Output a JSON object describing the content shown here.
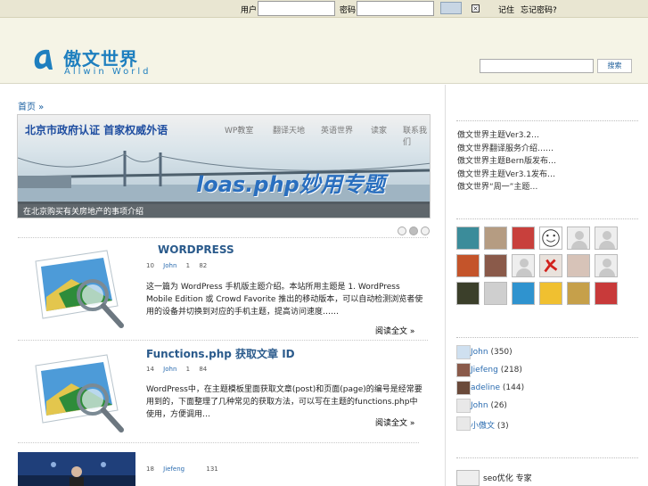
{
  "topbar": {
    "username_label": "用户",
    "password_label": "密码",
    "username_value": "",
    "password_value": "",
    "remember_label": "记住",
    "forgot_label": "忘记密码?"
  },
  "header": {
    "logo_cn": "傲文世界",
    "logo_en": "Allwin World",
    "search_value": "",
    "search_button": "搜索"
  },
  "breadcrumb": "首页 »",
  "slider": {
    "nav_items": [
      "WP教室",
      "翻译天地",
      "英语世界",
      "读家",
      "联系我们"
    ],
    "headline": "北京市政府认证 首家权威外语",
    "overlay": "Ajax以及WordPress.php妙用专题",
    "overlay_visible": "loas.php妙用专题",
    "caption": "在北京购买有关房地产的事项介绍",
    "dots": 3,
    "active_dot": 1
  },
  "posts": [
    {
      "title": "WORDPRESS",
      "day": "10",
      "author": "John",
      "comments": "1",
      "views": "82",
      "excerpt": "这一篇为 WordPress 手机版主题介绍。本站所用主题是 1. WordPress Mobile Edition 或 Crowd Favorite 推出的移动版本，可以自动检测浏览者使用的设备并切换到对应的手机主题，提高访问速度……",
      "more": "阅读全文 »"
    },
    {
      "title": "Functions.php 获取文章 ID",
      "day": "14",
      "author": "John",
      "comments": "1",
      "views": "84",
      "excerpt": "WordPress中，在主题模板里面获取文章(post)和页面(page)的编号是经常要用到的，下面整理了几种常见的获取方法，可以写在主题的functions.php中使用，方便调用…",
      "more": "阅读全文 »"
    },
    {
      "title": "",
      "day": "18",
      "author": "Jiefeng",
      "comments": "",
      "views": "131",
      "excerpt": "",
      "more": ""
    }
  ],
  "sidebar": {
    "recent": [
      "傲文世界主题Ver3.2…",
      "傲文世界翻译服务介绍……",
      "傲文世界主题Bern版发布…",
      "傲文世界主题Ver3.1发布…",
      "傲文世界“周一”主题…"
    ],
    "top_authors": [
      {
        "name": "John",
        "count": "(350)"
      },
      {
        "name": "Jiefeng",
        "count": "(218)"
      },
      {
        "name": "adeline",
        "count": "(144)"
      },
      {
        "name": "John",
        "count": "(26)"
      },
      {
        "name": "小傲文",
        "count": "(3)"
      }
    ],
    "seo_label": "seo优化 专家",
    "colors": {
      "accent": "#1e7fbf",
      "link": "#2b6cb0",
      "header_bg": "#f5f4e6",
      "topbar_bg": "#e9e6d2"
    }
  }
}
